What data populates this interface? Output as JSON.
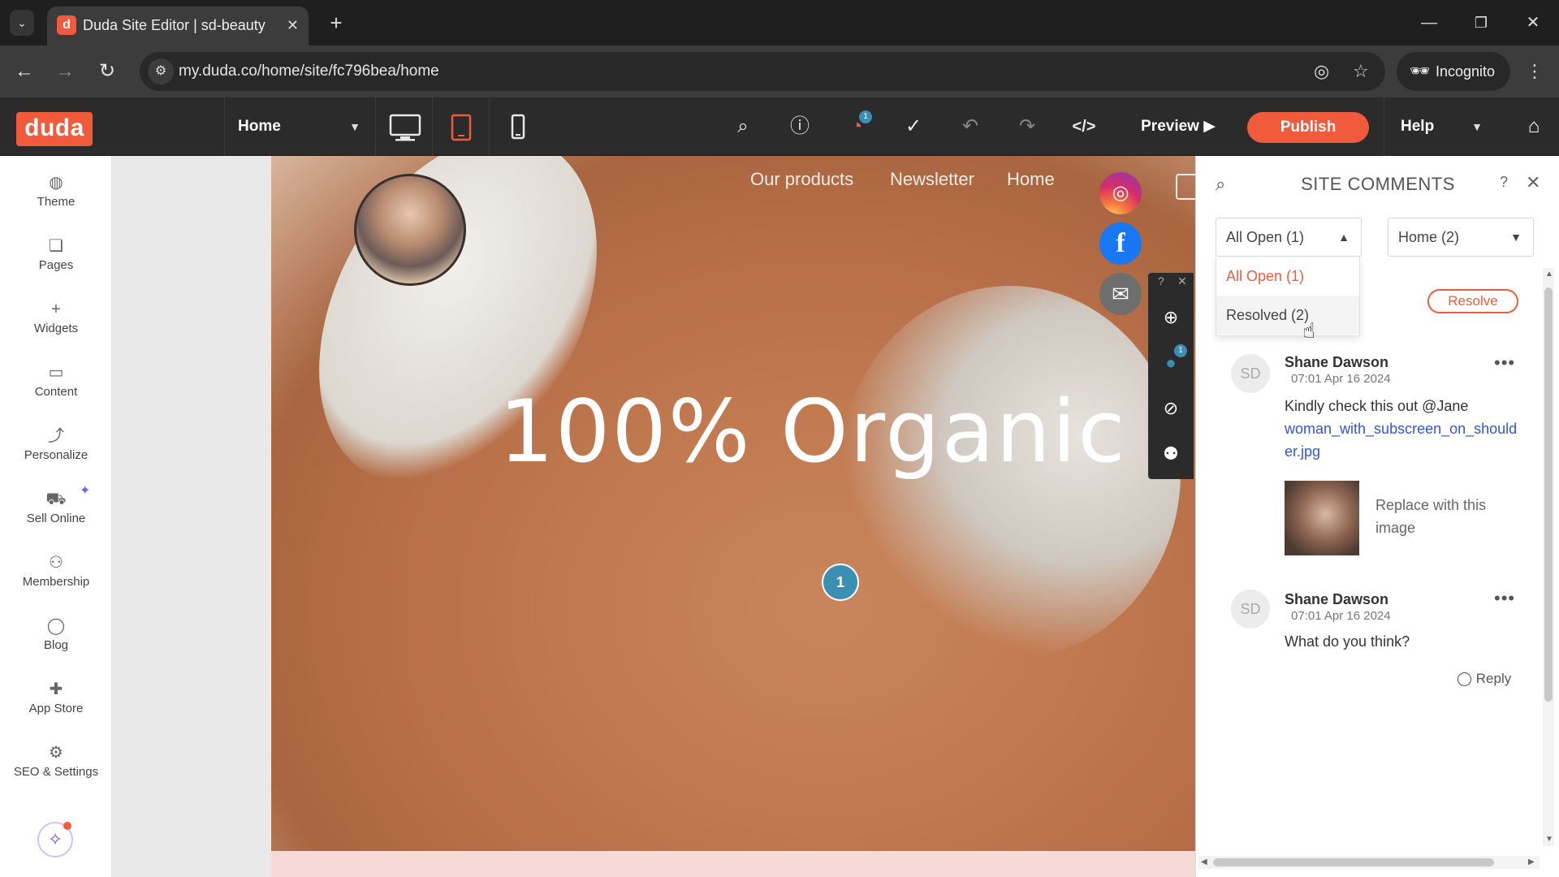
{
  "browser": {
    "tab_title": "Duda Site Editor | sd-beauty",
    "favicon_letter": "d",
    "url": "my.duda.co/home/site/fc796bea/home",
    "incognito_label": "Incognito"
  },
  "editor": {
    "logo": "duda",
    "page_select": "Home",
    "preview_label": "Preview",
    "publish_label": "Publish",
    "help_label": "Help",
    "notification_count": "1"
  },
  "sidebar": {
    "items": [
      {
        "label": "Theme",
        "icon": "palette-icon"
      },
      {
        "label": "Pages",
        "icon": "pages-icon"
      },
      {
        "label": "Widgets",
        "icon": "plus-icon"
      },
      {
        "label": "Content",
        "icon": "folder-icon"
      },
      {
        "label": "Personalize",
        "icon": "personalize-icon"
      },
      {
        "label": "Sell Online",
        "icon": "cart-icon"
      },
      {
        "label": "Membership",
        "icon": "user-icon"
      },
      {
        "label": "Blog",
        "icon": "chat-bubble-icon"
      },
      {
        "label": "App Store",
        "icon": "puzzle-icon"
      },
      {
        "label": "SEO & Settings",
        "icon": "gear-icon"
      }
    ]
  },
  "canvas": {
    "nav": [
      "Our products",
      "Newsletter",
      "Home"
    ],
    "hero_title": "100% Organic",
    "pin_number": "1",
    "tools_badge": "1"
  },
  "comments_panel": {
    "title": "SITE COMMENTS",
    "filter_status": "All Open (1)",
    "filter_page": "Home (2)",
    "dropdown": [
      {
        "label": "All Open (1)",
        "selected": true
      },
      {
        "label": "Resolved (2)",
        "selected": false
      }
    ],
    "resolve_label": "Resolve",
    "comments": [
      {
        "initials": "SD",
        "author": "Shane Dawson",
        "time": "07:01 Apr 16 2024",
        "text": "Kindly check this out @Jane",
        "link": "woman_with_subscreen_on_shoulder.jpg",
        "caption": "Replace with this image"
      },
      {
        "initials": "SD",
        "author": "Shane Dawson",
        "time": "07:01 Apr 16 2024",
        "text": "What do you think?"
      }
    ],
    "reply_label": "Reply"
  },
  "colors": {
    "brand": "#f15a3a",
    "link": "#3355d6",
    "pin": "#3b8fb3"
  }
}
